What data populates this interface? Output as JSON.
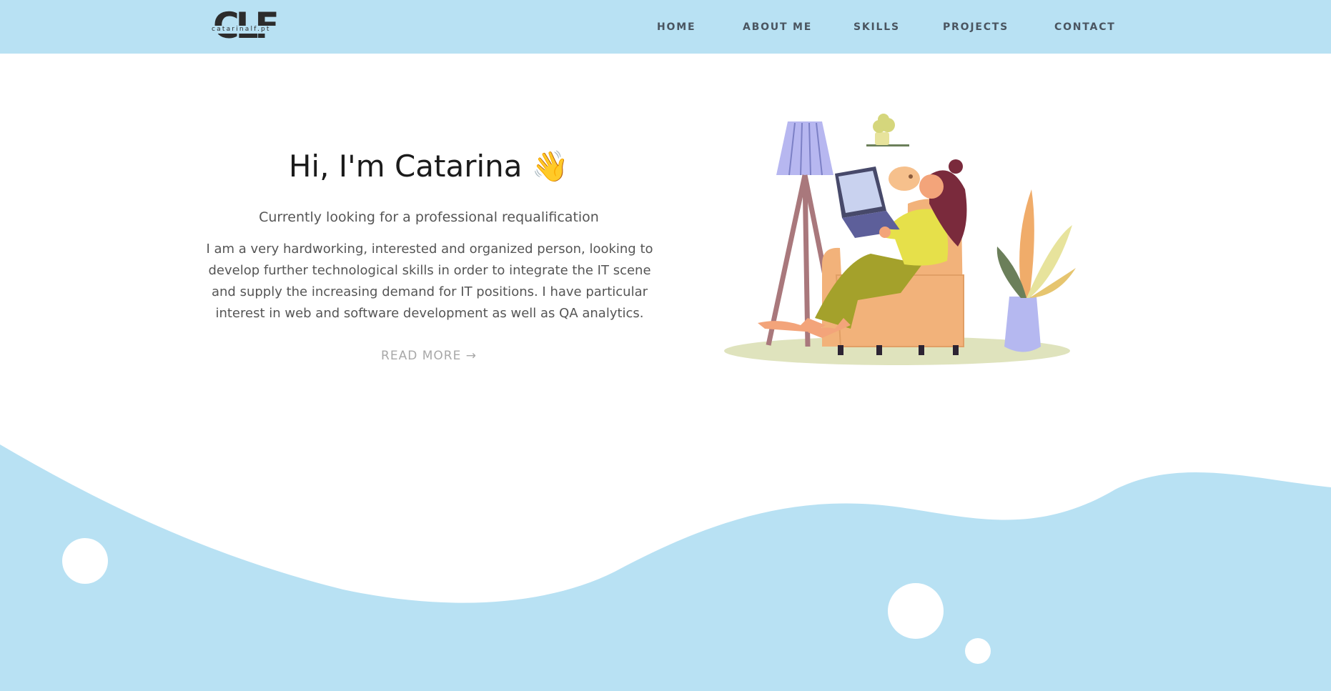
{
  "brand": {
    "logo_text": "CLF",
    "logo_subtext": "catarinalf.pt"
  },
  "nav": {
    "items": [
      {
        "label": "HOME"
      },
      {
        "label": "ABOUT ME"
      },
      {
        "label": "SKILLS"
      },
      {
        "label": "PROJECTS"
      },
      {
        "label": "CONTACT"
      }
    ]
  },
  "hero": {
    "title": "Hi, I'm Catarina 👋",
    "subtitle": "Currently looking for a professional requalification",
    "description": "I am a very hardworking, interested and organized person, looking to develop further technological skills in order to integrate the IT scene and supply the increasing demand for IT positions. I have particular interest in web and software development as well as QA analytics.",
    "read_more": "READ MORE →"
  },
  "colors": {
    "accent": "#b8e1f3",
    "text_dark": "#1b1b1b",
    "text_muted": "#555555",
    "link_muted": "#a8a8a8"
  },
  "illustration": {
    "icon": "woman-working-on-laptop-illustration"
  }
}
